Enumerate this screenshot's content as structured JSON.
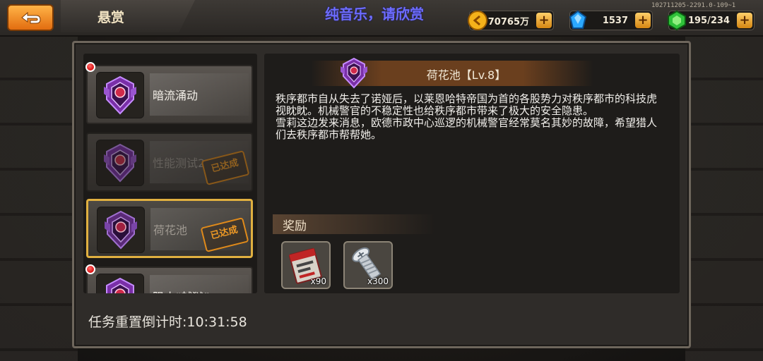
{
  "header": {
    "title": "悬赏",
    "overlay": "纯音乐，请欣赏",
    "version": "102711205-2291.0-109~1"
  },
  "resources": [
    {
      "icon": "gold-coin-icon",
      "value": "70765万"
    },
    {
      "icon": "blue-gem-icon",
      "value": "1537"
    },
    {
      "icon": "green-energy-icon",
      "value": "195/234"
    }
  ],
  "quests": [
    {
      "name": "暗流涌动",
      "status": "new",
      "badge": ""
    },
    {
      "name": "性能测试2",
      "status": "completed",
      "badge": "已达成"
    },
    {
      "name": "荷花池",
      "status": "completed-selected",
      "badge": "已达成"
    },
    {
      "name": "阻止“越狱”",
      "status": "new",
      "badge": ""
    }
  ],
  "detail": {
    "title": "荷花池【Lv.8】",
    "description": [
      "秩序都市自从失去了诺娅后，以莱恩哈特帝国为首的各股势力对秩序都市的科技虎视眈眈。机械警官的不稳定性也给秩序都市带来了极大的安全隐患。",
      "雪莉这边发来消息，欧德市政中心巡逻的机械警官经常莫名其妙的故障，希望猎人们去秩序都市帮帮她。"
    ],
    "reward_label": "奖励",
    "rewards": [
      {
        "icon": "ticket-scroll-icon",
        "count": "x90"
      },
      {
        "icon": "screw-icon",
        "count": "x300"
      }
    ]
  },
  "footer": {
    "reset_countdown": "任务重置倒计时:10:31:58"
  },
  "colors": {
    "accent_orange": "#e26d10",
    "selected_border": "#e0b040",
    "badge_orange": "#f09a25",
    "overlay_blue": "#6d6cff"
  }
}
